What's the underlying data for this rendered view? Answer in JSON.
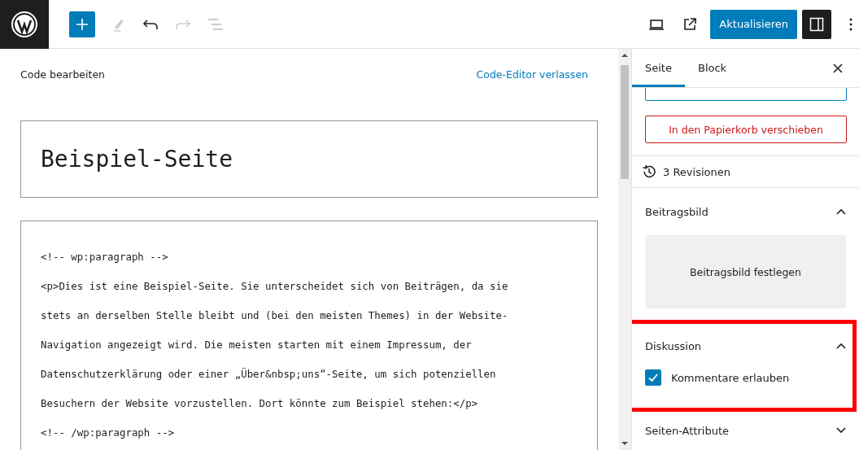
{
  "toolbar": {
    "publish_button": "Aktualisieren",
    "settings_selected": true
  },
  "editor": {
    "heading": "Code bearbeiten",
    "exit_link": "Code-Editor verlassen",
    "title": "Beispiel-Seite",
    "code_lines": [
      "<!-- wp:paragraph -->",
      "<p>Dies ist eine Beispiel-Seite. Sie unterscheidet sich von Beiträgen, da sie",
      "stets an derselben Stelle bleibt und (bei den meisten Themes) in der Website-",
      "Navigation angezeigt wird. Die meisten starten mit einem Impressum, der",
      "Datenschutzerklärung oder einer „Über&nbsp;uns“-Seite, um sich potenziellen",
      "Besuchern der Website vorzustellen. Dort könnte zum Beispiel stehen:</p>",
      "<!-- /wp:paragraph -->"
    ]
  },
  "sidebar": {
    "tabs": [
      {
        "label": "Seite",
        "selected": true
      },
      {
        "label": "Block",
        "selected": false
      }
    ],
    "trash_button": "In den Papierkorb verschieben",
    "revisions": "3 Revisionen",
    "panels": [
      {
        "title": "Beitragsbild",
        "expanded": true,
        "highlighted": false,
        "kind": "image",
        "button": "Beitragsbild festlegen"
      },
      {
        "title": "Diskussion",
        "expanded": true,
        "highlighted": true,
        "kind": "checkbox",
        "label": "Kommentare erlauben",
        "checked": true
      },
      {
        "title": "Seiten-Attribute",
        "expanded": false,
        "highlighted": false,
        "kind": "plain"
      }
    ]
  }
}
